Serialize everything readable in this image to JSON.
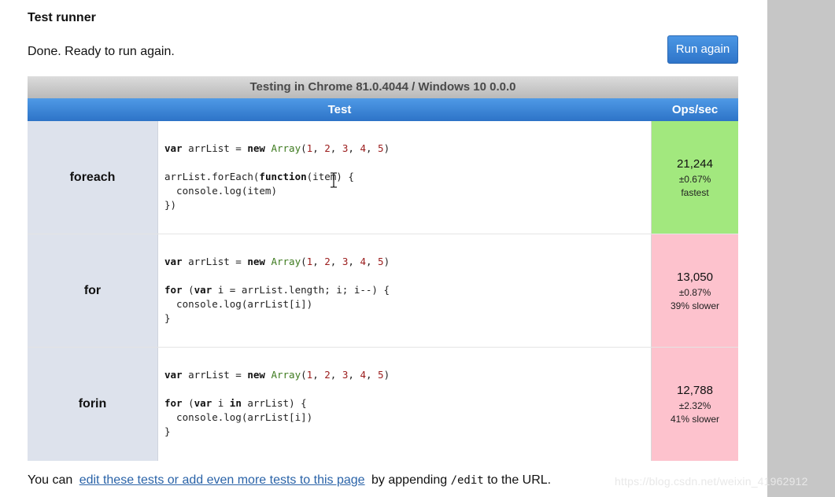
{
  "header": {
    "title": "Test runner",
    "status": "Done. Ready to run again.",
    "run_button": "Run again"
  },
  "table": {
    "environment": "Testing in Chrome 81.0.4044 / Windows 10 0.0.0",
    "col_test": "Test",
    "col_ops": "Ops/sec",
    "rows": [
      {
        "name": "foreach",
        "code": [
          "var arrList = new Array(1, 2, 3, 4, 5)",
          "",
          "arrList.forEach(function(item) {",
          "  console.log(item)",
          "})"
        ],
        "ops": "21,244",
        "error": "±0.67%",
        "rank": "fastest",
        "status_color": "#a2e87e"
      },
      {
        "name": "for",
        "code": [
          "var arrList = new Array(1, 2, 3, 4, 5)",
          "",
          "for (var i = arrList.length; i; i--) {",
          "  console.log(arrList[i])",
          "}"
        ],
        "ops": "13,050",
        "error": "±0.87%",
        "rank": "39% slower",
        "status_color": "#fdc2cd"
      },
      {
        "name": "forin",
        "code": [
          "var arrList = new Array(1, 2, 3, 4, 5)",
          "",
          "for (var i in arrList) {",
          "  console.log(arrList[i])",
          "}"
        ],
        "ops": "12,788",
        "error": "±2.32%",
        "rank": "41% slower",
        "status_color": "#fdc2cd"
      }
    ]
  },
  "footer": {
    "prefix": "You can",
    "link": "edit these tests or add even more tests to this page",
    "middle": "by appending",
    "path": "/edit",
    "suffix": "to the URL."
  },
  "watermark": "https://blog.csdn.net/weixin_41962912",
  "colors": {
    "accent_blue": "#2f75c9",
    "fastest_green": "#a2e87e",
    "slower_pink": "#fdc2cd"
  },
  "icons": {
    "text_cursor": "text-cursor-icon"
  }
}
